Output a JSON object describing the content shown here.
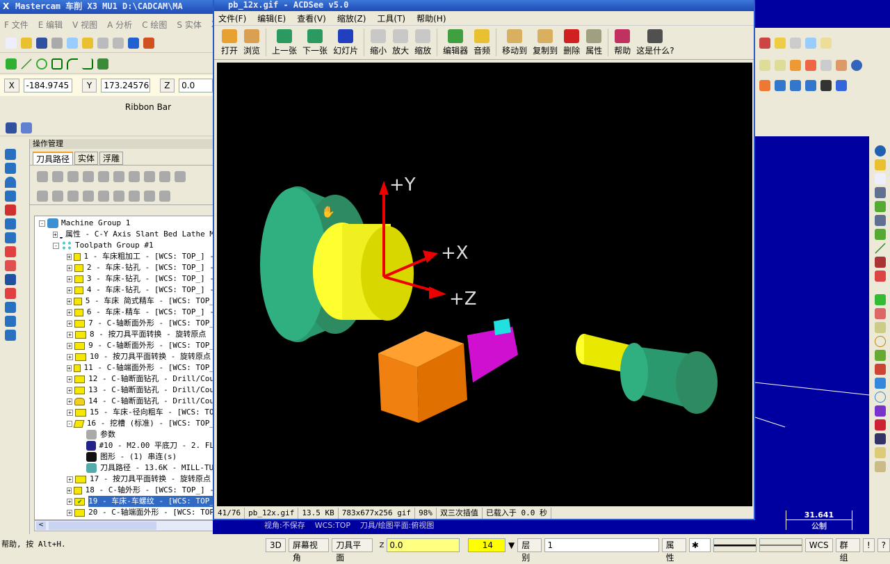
{
  "mastercam": {
    "title": "Mastercam 车削  X3 MU1  D:\\CADCAM\\MA",
    "menu": [
      "F 文件",
      "E 编辑",
      "V 视图",
      "A 分析",
      "C 绘图",
      "S 实体",
      "X"
    ],
    "coords": {
      "x_label": "X",
      "x_value": "-184.9745",
      "y_label": "Y",
      "y_value": "173.24576",
      "z_label": "Z",
      "z_value": "0.0"
    },
    "ribbon_bar": "Ribbon Bar",
    "ops_manager": {
      "title": "操作管理",
      "tabs": [
        "刀具路径",
        "实体",
        "浮雕"
      ]
    },
    "tree": {
      "root": "Machine Group 1",
      "props": "属性 - C-Y Axis Slant Bed Lathe M",
      "group": "Toolpath Group #1",
      "ops": [
        "1 - 车床粗加工 - [WCS: TOP_] -",
        "2 - 车床-钻孔 - [WCS: TOP_] -",
        "3 - 车床-钻孔 - [WCS: TOP_] -",
        "4 - 车床-钻孔 - [WCS: TOP_] -",
        "5 - 车床 简式精车 - [WCS: TOP_",
        "6 - 车床-精车 - [WCS: TOP_] -",
        "7 - C-轴断面外形 - [WCS: TOP_",
        "8 - 按刀具平面转换 - 旋转原点",
        "9 - C-轴断面外形 - [WCS: TOP_",
        "10 - 按刀具平面转换 - 旋转原点",
        "11 - C-轴端面外形 - [WCS: TOP_",
        "12 - C-轴断面钻孔 - Drill/Cou",
        "13 - C-轴断面钻孔 - Drill/Cou",
        "14 - C-轴断面钻孔 - Drill/Cou",
        "15 - 车床-径向粗车 - [WCS: TO",
        "16 - 挖槽 (标准) - [WCS: TOP_"
      ],
      "op16_children": [
        "参数",
        "#10 - M2.00 平底刀 - 2. FL",
        "图形 - (1) 串连(s)",
        "刀具路径 - 13.6K - MILL-TU"
      ],
      "ops_after": [
        "17 - 按刀具平面转换 - 旋转原点",
        "18 - C-轴外形 - [WCS: TOP_] -",
        "19 - 车床-车螺纹 - [WCS: TOP_",
        "20 - C-轴端面外形 - [WCS: TOP"
      ],
      "selected": "19 - 车床-车螺纹 - [WCS: TOP_"
    },
    "view_status": "视角:不保存    WCS:TOP    刀具/绘图平面:俯视图",
    "scale_value": "31.641",
    "scale_unit": "公制",
    "help_text": "帮助, 按 Alt+H.",
    "bottom": {
      "b3d": "3D",
      "screen_view": "屏幕视角",
      "tool_plane": "刀具平面",
      "z_label": "Z",
      "z_value": "0.0",
      "color_value": "14",
      "level_label": "层别",
      "level_value": "1",
      "attr": "属性",
      "wcs": "WCS",
      "group": "群组",
      "bang": "!",
      "q": "?"
    }
  },
  "acdsee": {
    "title": "pb_12x.gif - ACDSee v5.0",
    "menu": [
      "文件(F)",
      "编辑(E)",
      "查看(V)",
      "缩放(Z)",
      "工具(T)",
      "帮助(H)"
    ],
    "toolbar": [
      {
        "label": "打开",
        "icon": "open-folder",
        "color": "#e8a030"
      },
      {
        "label": "浏览",
        "icon": "browse",
        "color": "#d8a050"
      },
      {
        "label": "上一张",
        "icon": "prev-arrow",
        "color": "#2a9a60"
      },
      {
        "label": "下一张",
        "icon": "next-arrow",
        "color": "#2a9a60"
      },
      {
        "label": "幻灯片",
        "icon": "slideshow",
        "color": "#2040c0"
      },
      {
        "label": "缩小",
        "icon": "zoom-out",
        "color": "#c8c8c8"
      },
      {
        "label": "放大",
        "icon": "zoom-in",
        "color": "#c8c8c8"
      },
      {
        "label": "缩放",
        "icon": "zoom",
        "color": "#c8c8c8"
      },
      {
        "label": "编辑器",
        "icon": "editor-wand",
        "color": "#40a040"
      },
      {
        "label": "音频",
        "icon": "speaker",
        "color": "#e8c030"
      },
      {
        "label": "移动到",
        "icon": "move-to",
        "color": "#d8b060"
      },
      {
        "label": "复制到",
        "icon": "copy-to",
        "color": "#d8b060"
      },
      {
        "label": "删除",
        "icon": "delete-x",
        "color": "#d02020"
      },
      {
        "label": "属性",
        "icon": "properties",
        "color": "#a0a080"
      },
      {
        "label": "帮助",
        "icon": "help-book",
        "color": "#c03060"
      },
      {
        "label": "这是什么?",
        "icon": "whats-this",
        "color": "#505050"
      }
    ],
    "image_labels": {
      "y": "+Y",
      "x": "+X",
      "z": "+Z"
    },
    "status": [
      "41/76",
      "pb_12x.gif",
      "13.5 KB",
      "783x677x256 gif",
      "98%",
      "双三次插值",
      "已载入于 0.0 秒"
    ]
  },
  "colors": {
    "graphics_bg": "#0000a0",
    "title_blue": "#2a5bc4",
    "selection": "#316ac5"
  }
}
